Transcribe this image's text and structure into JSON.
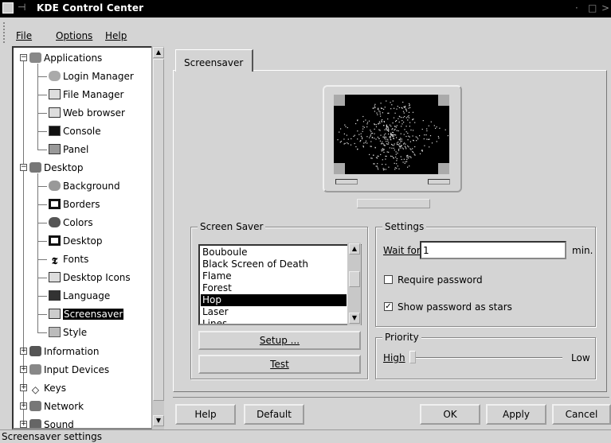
{
  "window": {
    "title": "KDE Control Center"
  },
  "menubar": {
    "file": "File",
    "options": "Options",
    "help": "Help"
  },
  "tree": {
    "items": [
      {
        "label": "Applications",
        "icon": "applications-icon"
      },
      {
        "label": "Login Manager",
        "icon": "login-manager-icon"
      },
      {
        "label": "File Manager",
        "icon": "file-manager-icon"
      },
      {
        "label": "Web browser",
        "icon": "web-browser-icon"
      },
      {
        "label": "Console",
        "icon": "console-icon"
      },
      {
        "label": "Panel",
        "icon": "panel-icon"
      },
      {
        "label": "Desktop",
        "icon": "desktop-folder-icon"
      },
      {
        "label": "Background",
        "icon": "background-icon"
      },
      {
        "label": "Borders",
        "icon": "borders-icon"
      },
      {
        "label": "Colors",
        "icon": "colors-icon"
      },
      {
        "label": "Desktop",
        "icon": "desktop-icon"
      },
      {
        "label": "Fonts",
        "icon": "fonts-icon"
      },
      {
        "label": "Desktop Icons",
        "icon": "desktop-icons-icon"
      },
      {
        "label": "Language",
        "icon": "language-icon"
      },
      {
        "label": "Screensaver",
        "icon": "screensaver-icon"
      },
      {
        "label": "Style",
        "icon": "style-icon"
      },
      {
        "label": "Information",
        "icon": "information-icon"
      },
      {
        "label": "Input Devices",
        "icon": "input-devices-icon"
      },
      {
        "label": "Keys",
        "icon": "keys-icon"
      },
      {
        "label": "Network",
        "icon": "network-icon"
      },
      {
        "label": "Sound",
        "icon": "sound-icon"
      }
    ],
    "selected": "Screensaver"
  },
  "tab": {
    "label": "Screensaver"
  },
  "screensaver_group": {
    "title": "Screen Saver",
    "items": [
      "Bouboule",
      "Black Screen of Death",
      "Flame",
      "Forest",
      "Hop",
      "Laser",
      "Lines"
    ],
    "selected": "Hop",
    "setup_button": "Setup ...",
    "test_button": "Test"
  },
  "settings_group": {
    "title": "Settings",
    "wait_label": "Wait for",
    "wait_value": "1",
    "wait_unit": "min.",
    "require_password": {
      "label": "Require password",
      "checked": false
    },
    "show_stars": {
      "label": "Show password as stars",
      "checked": true
    }
  },
  "priority_group": {
    "title": "Priority",
    "high_label": "High",
    "low_label": "Low",
    "level": 0.0
  },
  "buttons": {
    "help": "Help",
    "default": "Default",
    "ok": "OK",
    "apply": "Apply",
    "cancel": "Cancel"
  },
  "status": {
    "text": "Screensaver settings"
  },
  "colors": {
    "selection": "#000000",
    "background": "#d4d4d4"
  }
}
